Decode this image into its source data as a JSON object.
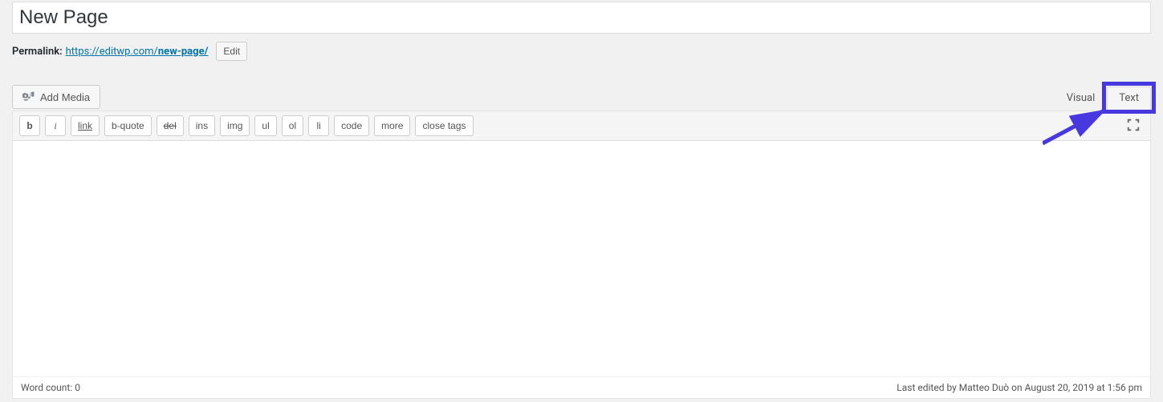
{
  "title": "New Page",
  "permalink": {
    "label": "Permalink:",
    "base": "https://editwp.com/",
    "slug": "new-page/",
    "edit_label": "Edit"
  },
  "media": {
    "add_media_label": "Add Media"
  },
  "tabs": {
    "visual": "Visual",
    "text": "Text"
  },
  "quicktags": [
    {
      "id": "b",
      "label": "b",
      "cls": "bold"
    },
    {
      "id": "i",
      "label": "i",
      "cls": "italic"
    },
    {
      "id": "link",
      "label": "link",
      "cls": "underline"
    },
    {
      "id": "bquote",
      "label": "b-quote",
      "cls": ""
    },
    {
      "id": "del",
      "label": "del",
      "cls": "strike"
    },
    {
      "id": "ins",
      "label": "ins",
      "cls": ""
    },
    {
      "id": "img",
      "label": "img",
      "cls": ""
    },
    {
      "id": "ul",
      "label": "ul",
      "cls": ""
    },
    {
      "id": "ol",
      "label": "ol",
      "cls": ""
    },
    {
      "id": "li",
      "label": "li",
      "cls": ""
    },
    {
      "id": "code",
      "label": "code",
      "cls": ""
    },
    {
      "id": "more",
      "label": "more",
      "cls": ""
    },
    {
      "id": "close",
      "label": "close tags",
      "cls": ""
    }
  ],
  "status": {
    "wordcount_label": "Word count:",
    "wordcount_value": "0",
    "last_edited": "Last edited by Matteo Duò on August 20, 2019 at 1:56 pm"
  },
  "annotations": {
    "highlight_target": "text-tab"
  }
}
